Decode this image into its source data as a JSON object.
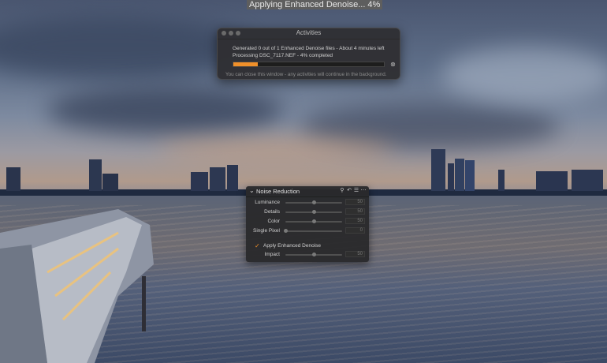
{
  "status_bar": {
    "text": "Applying Enhanced Denoise... 4%"
  },
  "activities": {
    "title": "Activities",
    "line1": "Generated 0 out of 1 Enhanced Denoise files - About 4 minutes left",
    "line2": "Processing DSC_7117.NEF - 4% completed",
    "progress": 0.04,
    "note": "You can close this window - any activities will continue in the background."
  },
  "noise_reduction": {
    "title": "Noise Reduction",
    "sliders": [
      {
        "label": "Luminance",
        "value": "50",
        "level": 0.5
      },
      {
        "label": "Details",
        "value": "50",
        "level": 0.5
      },
      {
        "label": "Color",
        "value": "50",
        "level": 0.5
      },
      {
        "label": "Single Pixel",
        "value": "0",
        "level": 0.0
      }
    ],
    "enhanced_denoise": {
      "label": "Apply Enhanced Denoise",
      "checked": true
    },
    "impact": {
      "label": "Impact",
      "value": "50",
      "level": 0.5
    }
  },
  "colors": {
    "accent": "#f0902a"
  }
}
